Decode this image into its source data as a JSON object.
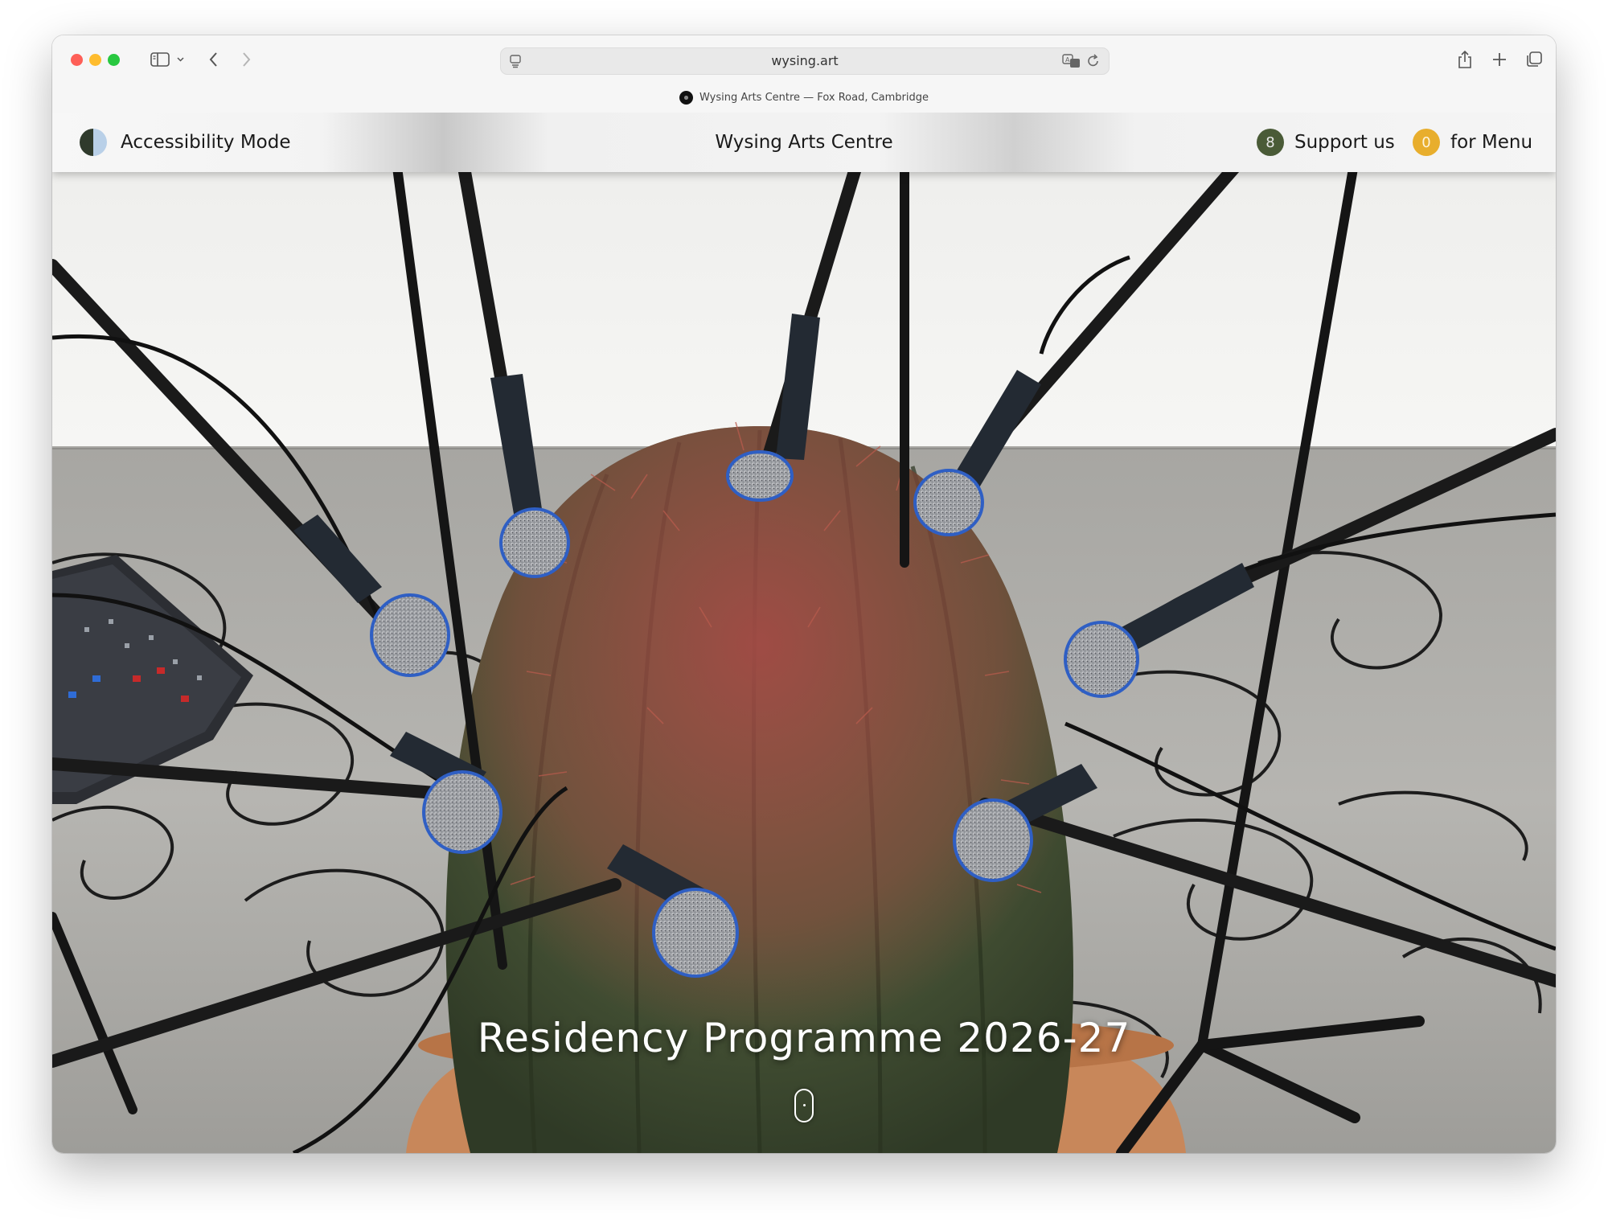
{
  "browser": {
    "url": "wysing.art",
    "tab_title": "Wysing Arts Centre — Fox Road, Cambridge"
  },
  "site": {
    "accessibility_label": "Accessibility Mode",
    "title": "Wysing Arts Centre",
    "support_count": "8",
    "support_label": "Support us",
    "menu_count": "0",
    "menu_label": "for Menu"
  },
  "hero": {
    "heading": "Residency Programme 2026-27",
    "image_subject": "barrel cactus in a terracotta pot surrounded by microphones on stands"
  },
  "colors": {
    "support_badge": "#4a5b37",
    "menu_badge": "#e8ae2d",
    "header_text": "#1a1a1a"
  },
  "icons": {
    "sidebar": "sidebar-icon",
    "back": "chevron-left-icon",
    "forward": "chevron-right-icon",
    "share": "share-icon",
    "new_tab": "plus-icon",
    "tabs": "tabs-overview-icon",
    "translate": "translate-icon",
    "reload": "reload-icon",
    "scroll": "scroll-down-icon"
  }
}
